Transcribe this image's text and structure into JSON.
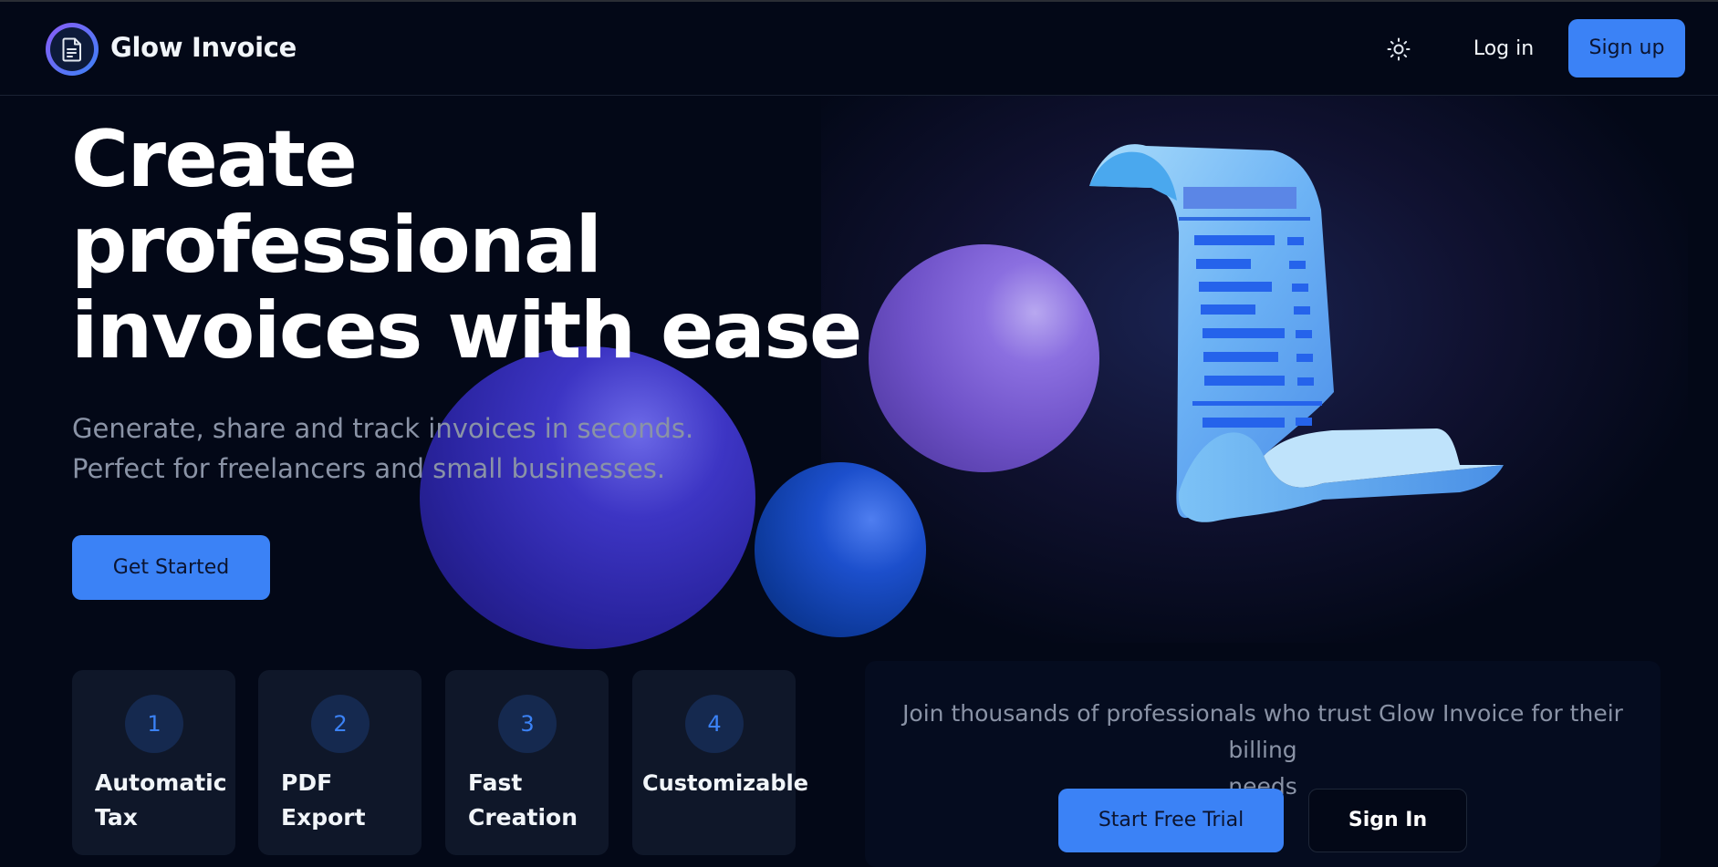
{
  "header": {
    "brand": "Glow Invoice",
    "logo_icon": "document-icon",
    "theme_toggle_icon": "sun-icon",
    "login_label": "Log in",
    "signup_label": "Sign up"
  },
  "hero": {
    "headline_lines": [
      "Create",
      "professional",
      "invoices with ease"
    ],
    "subtitle_lines": [
      "Generate, share and track invoices in seconds.",
      "Perfect for freelancers and small businesses."
    ],
    "cta_label": "Get Started"
  },
  "features": [
    {
      "number": "1",
      "label_lines": [
        "Automatic",
        "Tax"
      ]
    },
    {
      "number": "2",
      "label_lines": [
        "PDF",
        "Export"
      ]
    },
    {
      "number": "3",
      "label_lines": [
        "Fast",
        "Creation"
      ]
    },
    {
      "number": "4",
      "label_lines": [
        "Customizable"
      ]
    }
  ],
  "cta_panel": {
    "text_lines": [
      "Join thousands of professionals who trust Glow Invoice for their billing",
      "needs"
    ],
    "primary_label": "Start Free Trial",
    "secondary_label": "Sign In"
  },
  "colors": {
    "background": "#030817",
    "accent": "#3b82f6",
    "card": "#0f1729",
    "muted_text": "#8a93a6"
  }
}
